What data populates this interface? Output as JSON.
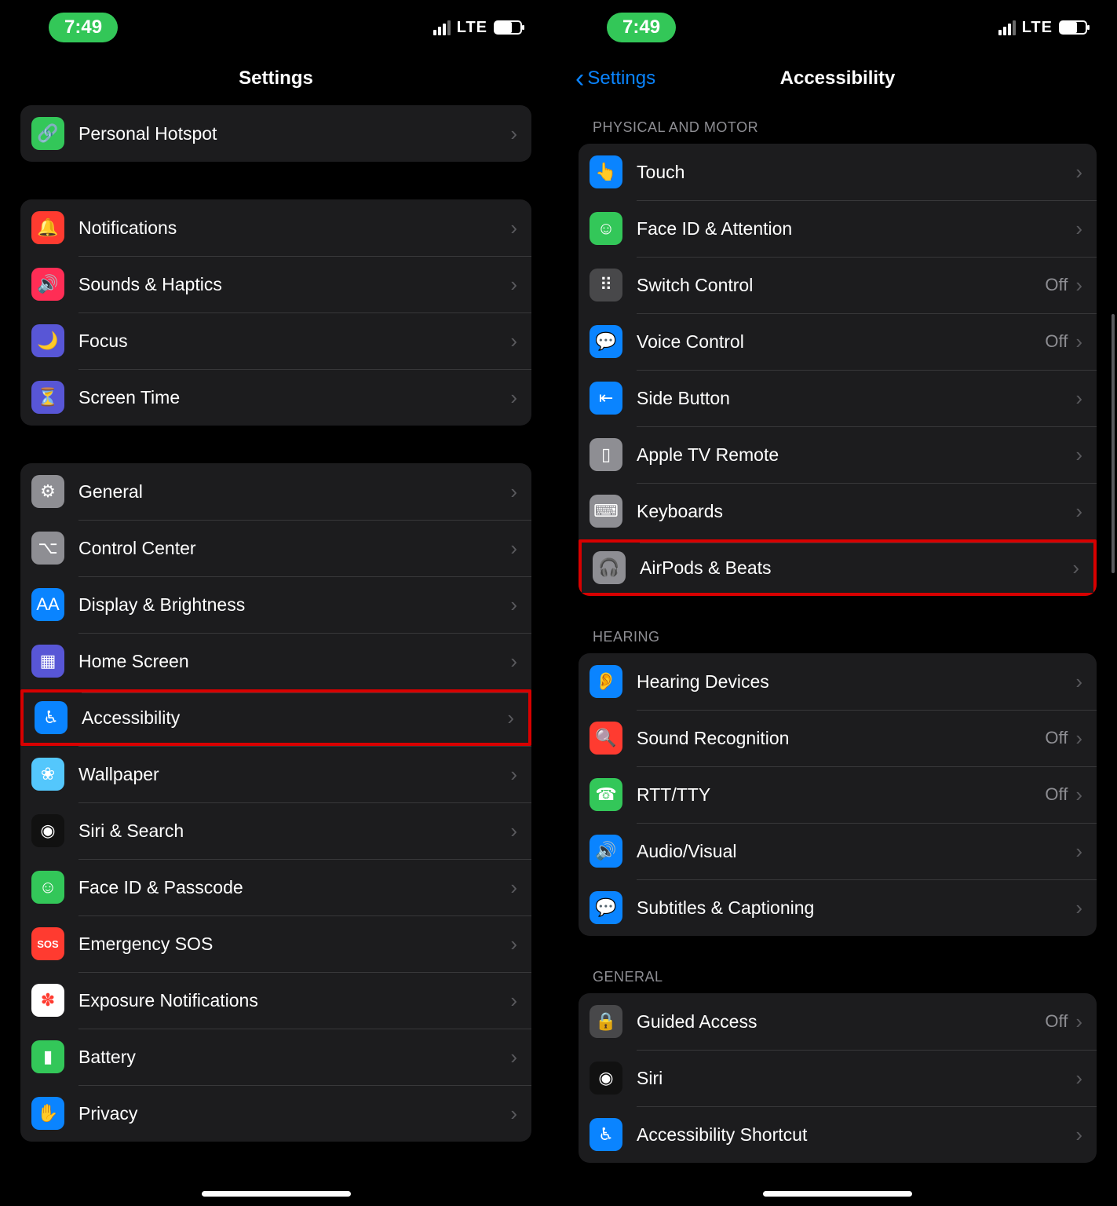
{
  "status": {
    "time": "7:49",
    "network": "LTE"
  },
  "left": {
    "title": "Settings",
    "group1": [
      {
        "icon": "link-icon",
        "bg": "bg-green",
        "glyph": "🔗",
        "label": "Personal Hotspot"
      }
    ],
    "group2": [
      {
        "icon": "bell-icon",
        "bg": "bg-red",
        "glyph": "🔔",
        "label": "Notifications"
      },
      {
        "icon": "sound-icon",
        "bg": "bg-pink",
        "glyph": "🔊",
        "label": "Sounds & Haptics"
      },
      {
        "icon": "moon-icon",
        "bg": "bg-indigo",
        "glyph": "🌙",
        "label": "Focus"
      },
      {
        "icon": "hourglass-icon",
        "bg": "bg-indigo",
        "glyph": "⏳",
        "label": "Screen Time"
      }
    ],
    "group3": [
      {
        "icon": "gear-icon",
        "bg": "bg-gray",
        "glyph": "⚙︎",
        "label": "General"
      },
      {
        "icon": "switches-icon",
        "bg": "bg-gray",
        "glyph": "⌥",
        "label": "Control Center"
      },
      {
        "icon": "text-size-icon",
        "bg": "bg-blue",
        "glyph": "AA",
        "label": "Display & Brightness"
      },
      {
        "icon": "grid-icon",
        "bg": "bg-indigo",
        "glyph": "▦",
        "label": "Home Screen"
      },
      {
        "icon": "accessibility-icon",
        "bg": "bg-blue",
        "glyph": "♿︎",
        "label": "Accessibility",
        "highlight": true
      },
      {
        "icon": "flower-icon",
        "bg": "bg-cyan",
        "glyph": "❀",
        "label": "Wallpaper"
      },
      {
        "icon": "siri-icon",
        "bg": "bg-black",
        "glyph": "◉",
        "label": "Siri & Search"
      },
      {
        "icon": "faceid-icon",
        "bg": "bg-green",
        "glyph": "☺︎",
        "label": "Face ID & Passcode"
      },
      {
        "icon": "sos-icon",
        "bg": "bg-red",
        "glyph": "SOS",
        "label": "Emergency SOS"
      },
      {
        "icon": "exposure-icon",
        "bg": "bg-white",
        "glyph": "✽",
        "label": "Exposure Notifications"
      },
      {
        "icon": "battery-icon",
        "bg": "bg-green",
        "glyph": "▮",
        "label": "Battery"
      },
      {
        "icon": "hand-icon",
        "bg": "bg-blue",
        "glyph": "✋",
        "label": "Privacy"
      }
    ]
  },
  "right": {
    "back": "Settings",
    "title": "Accessibility",
    "sections": [
      {
        "header": "PHYSICAL AND MOTOR",
        "rows": [
          {
            "icon": "touch-icon",
            "bg": "bg-blue",
            "glyph": "👆",
            "label": "Touch"
          },
          {
            "icon": "face-attention-icon",
            "bg": "bg-green",
            "glyph": "☺︎",
            "label": "Face ID & Attention"
          },
          {
            "icon": "switch-control-icon",
            "bg": "bg-darkgray",
            "glyph": "⠿",
            "label": "Switch Control",
            "value": "Off"
          },
          {
            "icon": "voice-control-icon",
            "bg": "bg-blue",
            "glyph": "💬",
            "label": "Voice Control",
            "value": "Off"
          },
          {
            "icon": "side-button-icon",
            "bg": "bg-blue",
            "glyph": "⇤",
            "label": "Side Button"
          },
          {
            "icon": "tv-remote-icon",
            "bg": "bg-gray",
            "glyph": "▯",
            "label": "Apple TV Remote"
          },
          {
            "icon": "keyboard-icon",
            "bg": "bg-gray",
            "glyph": "⌨︎",
            "label": "Keyboards"
          },
          {
            "icon": "headphones-icon",
            "bg": "bg-gray",
            "glyph": "🎧",
            "label": "AirPods & Beats",
            "highlight": true
          }
        ]
      },
      {
        "header": "HEARING",
        "rows": [
          {
            "icon": "ear-icon",
            "bg": "bg-blue",
            "glyph": "👂",
            "label": "Hearing Devices"
          },
          {
            "icon": "sound-recognition-icon",
            "bg": "bg-red",
            "glyph": "🔍",
            "label": "Sound Recognition",
            "value": "Off"
          },
          {
            "icon": "rtt-icon",
            "bg": "bg-green",
            "glyph": "☎︎",
            "label": "RTT/TTY",
            "value": "Off"
          },
          {
            "icon": "audio-visual-icon",
            "bg": "bg-blue",
            "glyph": "🔊",
            "label": "Audio/Visual"
          },
          {
            "icon": "subtitles-icon",
            "bg": "bg-blue",
            "glyph": "💬",
            "label": "Subtitles & Captioning"
          }
        ]
      },
      {
        "header": "GENERAL",
        "rows": [
          {
            "icon": "guided-access-icon",
            "bg": "bg-darkgray",
            "glyph": "🔒",
            "label": "Guided Access",
            "value": "Off"
          },
          {
            "icon": "siri-icon",
            "bg": "bg-black",
            "glyph": "◉",
            "label": "Siri"
          },
          {
            "icon": "shortcut-icon",
            "bg": "bg-blue",
            "glyph": "♿︎",
            "label": "Accessibility Shortcut"
          }
        ]
      }
    ]
  }
}
